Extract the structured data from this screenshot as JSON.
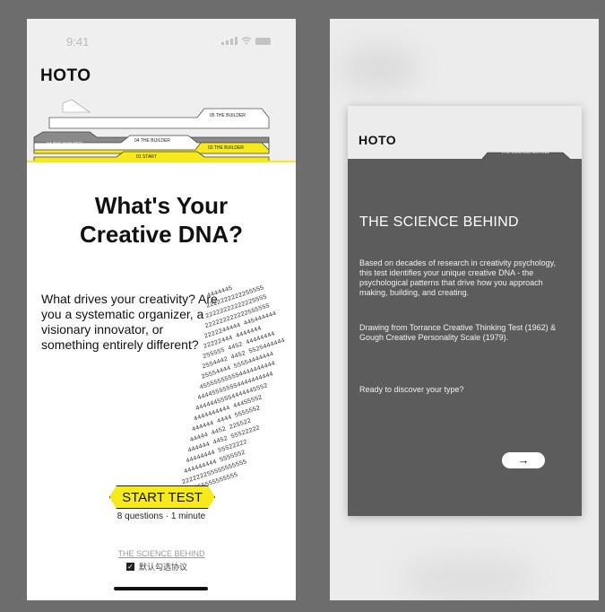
{
  "left_screen": {
    "status_time": "9:41",
    "brand": "HOTO",
    "tabs": [
      {
        "label": "05 THE BUILDER"
      },
      {
        "label": "04 THE BUILDER"
      },
      {
        "label": "04 THE BUILDER"
      },
      {
        "label": "03 THE BUILDER"
      },
      {
        "label": "01 START"
      }
    ],
    "headline_line1": "What's Your",
    "headline_line2": "Creative DNA?",
    "intro": "What drives your creativity? Are you a systematic organizer, a visionary innovator, or something entirely different?",
    "dna_rows": [
      "4444445",
      "2222222222255555",
      "22222222222225555",
      "222222222222555555",
      "2222244444  445444444",
      "22222444   4444444",
      "255555   4452   44444444",
      "2554442   4452   5525444444",
      "25554444   55554444444",
      "455555555554444444444",
      "444455555554444444444",
      "44444455554444445552",
      "4444444444   44455552",
      "444444   4444   5555552",
      "44444   4452   225522",
      "444444   4452   55522222",
      "44444444   55522222",
      "444444444   5555552",
      "222222255555555555",
      "2222255555555555",
      "55555555"
    ],
    "start_button": "START TEST",
    "start_sub": "8 questions · 1 minute",
    "science_link": "THE SCIENCE BEHIND",
    "agree_text": "默认勾选协议",
    "accent_color": "#f6ea1b"
  },
  "right_screen": {
    "brand": "HOTO",
    "tab_label": "THE SCIENCE BEHIND",
    "title": "THE SCIENCE BEHIND",
    "paragraph1": "Based on decades of research in creativity psychology, this test identifies your unique creative DNA - the psychological patterns that drive how you approach making, building, and creating.",
    "paragraph2": "Drawing from Torrance Creative Thinking Test (1962) & Gough Creative Personality Scale (1979).",
    "paragraph3": "Ready to discover your type?",
    "next_arrow": "→",
    "card_color": "#5c5c5c"
  }
}
